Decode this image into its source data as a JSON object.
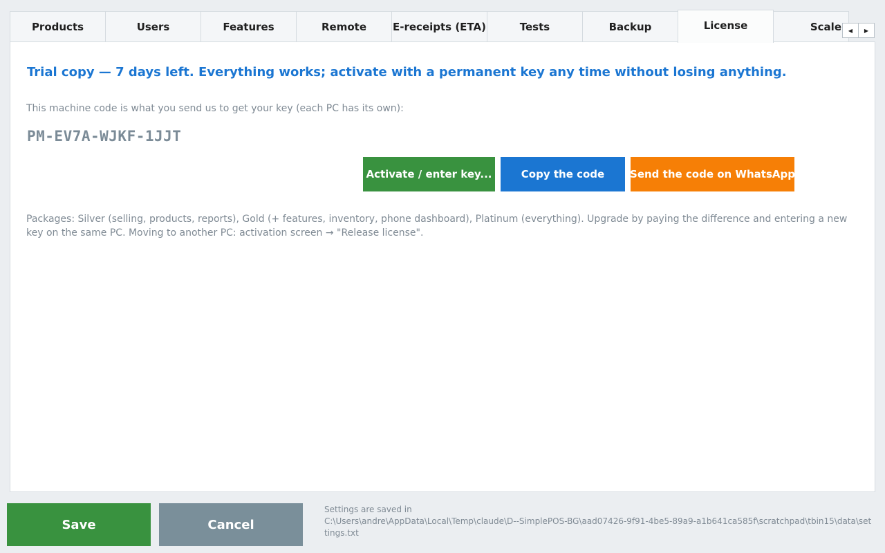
{
  "tabs": [
    {
      "label": "Products"
    },
    {
      "label": "Users"
    },
    {
      "label": "Features"
    },
    {
      "label": "Remote"
    },
    {
      "label": "E-receipts (ETA)"
    },
    {
      "label": "Tests"
    },
    {
      "label": "Backup"
    },
    {
      "label": "License",
      "active": true
    },
    {
      "label": "Scale"
    }
  ],
  "tab_scroll": {
    "left_icon": "triangle-left",
    "right_icon": "triangle-right"
  },
  "license": {
    "trial_message": "Trial copy — 7 days left. Everything works; activate with a permanent key any time without losing anything.",
    "machine_code_label": "This machine code is what you send us to get your key (each PC has its own):",
    "machine_code": "PM-EV7A-WJKF-1JJT",
    "buttons": {
      "activate": "Activate / enter key...",
      "copy": "Copy the code",
      "whatsapp": "Send the code on WhatsApp"
    },
    "packages_text": "Packages: Silver (selling, products, reports), Gold (+ features, inventory, phone dashboard), Platinum (everything). Upgrade by paying the difference and entering a new key on the same PC. Moving to another PC: activation screen → \"Release license\"."
  },
  "footer": {
    "save_label": "Save",
    "cancel_label": "Cancel",
    "saved_in_label": "Settings are saved in",
    "saved_path": "C:\\Users\\andre\\AppData\\Local\\Temp\\claude\\D--SimplePOS-BG\\aad07426-9f91-4be5-89a9-a1b641ca585f\\scratchpad\\tbin15\\data\\settings.txt"
  },
  "colors": {
    "accent_blue": "#1b76d2",
    "success_green": "#39923f",
    "whatsapp_orange": "#f67f06",
    "cancel_gray": "#7a8f9a"
  }
}
